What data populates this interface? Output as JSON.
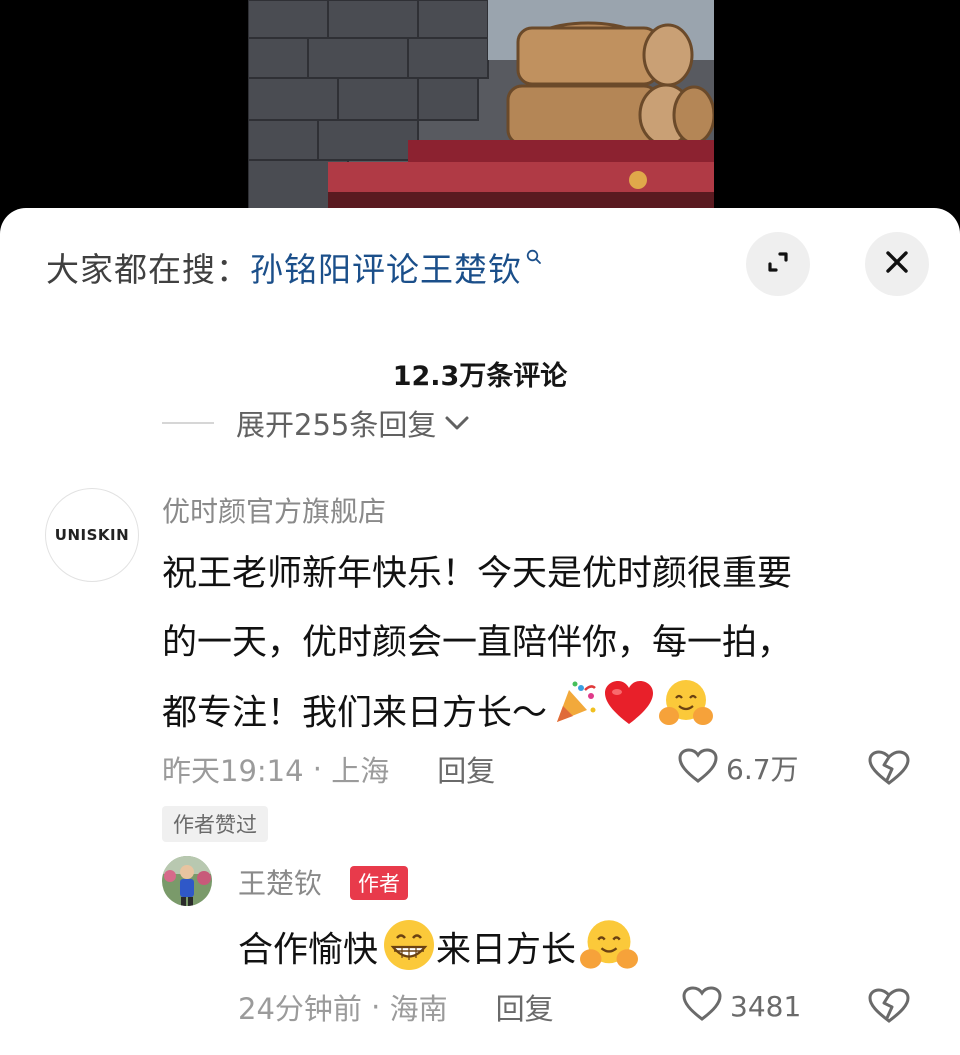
{
  "search": {
    "prefix": "大家都在搜：",
    "term": "孙铭阳评论王楚钦"
  },
  "icons": {
    "search": "magnifier-icon",
    "expand": "expand-icon",
    "close": "close-icon",
    "chevron": "chevron-down-icon",
    "like": "heart-outline-icon",
    "dislike": "broken-heart-icon"
  },
  "colors": {
    "search_term": "#1b4f8a",
    "author_tag": "#e83a4b",
    "heart_emoji": "#e8202a"
  },
  "comments_header": {
    "count": "12.3万条评论",
    "expand_label": "展开255条回复"
  },
  "comment": {
    "avatar_text": "UNISKIN",
    "username": "优时颜官方旗舰店",
    "lines": [
      "祝王老师新年快乐！今天是优时颜很重要",
      "的一天，优时颜会一直陪伴你，每一拍，",
      "都专注！我们来日方长～"
    ],
    "time": "昨天19:14",
    "location": "上海",
    "reply_label": "回复",
    "likes": "6.7万",
    "author_liked_badge": "作者赞过"
  },
  "reply": {
    "username": "王楚钦",
    "author_tag": "作者",
    "text_part1": "合作愉快",
    "text_part2": "来日方长",
    "time": "24分钟前",
    "location": "海南",
    "reply_label": "回复",
    "likes": "3481"
  }
}
